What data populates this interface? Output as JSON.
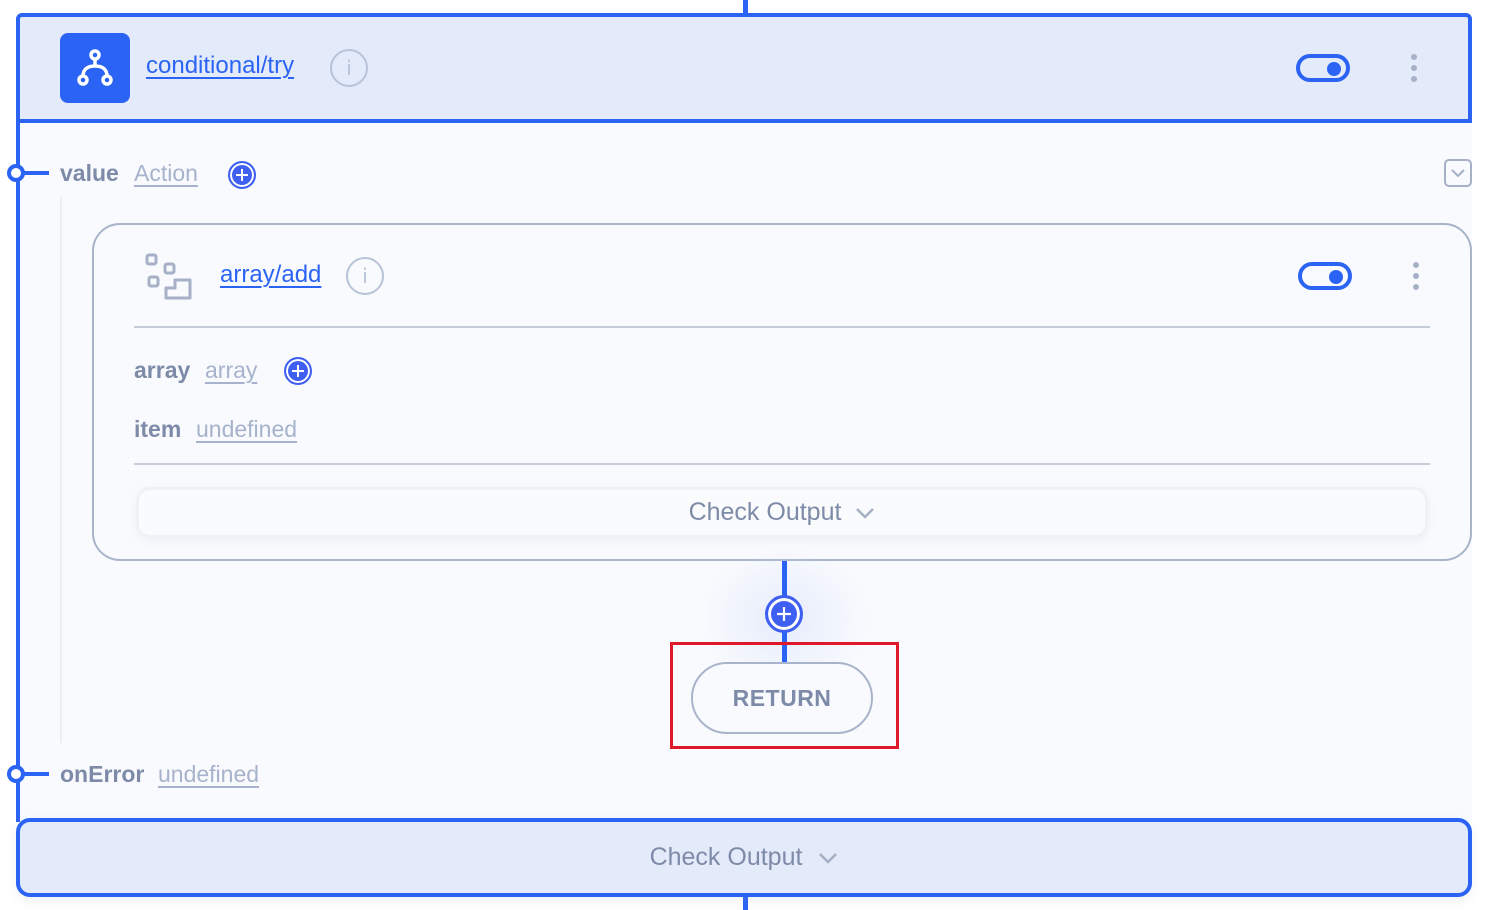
{
  "node": {
    "title": "conditional/try",
    "icon": "branch-icon",
    "enabled": true,
    "params": [
      {
        "name": "value",
        "type": "Action",
        "has_add": true
      },
      {
        "name": "onError",
        "type": "undefined",
        "has_add": false
      }
    ],
    "check_output_label": "Check Output"
  },
  "inner_node": {
    "title": "array/add",
    "icon": "array-steps-icon",
    "enabled": true,
    "params": [
      {
        "name": "array",
        "type": "array",
        "has_add": true
      },
      {
        "name": "item",
        "type": "undefined",
        "has_add": false
      }
    ],
    "check_output_label": "Check Output"
  },
  "flow": {
    "return_label": "RETURN"
  },
  "colors": {
    "accent": "#2b63f5",
    "header_bg": "#e3eaf9",
    "muted_text": "#7d8aa8",
    "highlight": "#e0192a"
  }
}
